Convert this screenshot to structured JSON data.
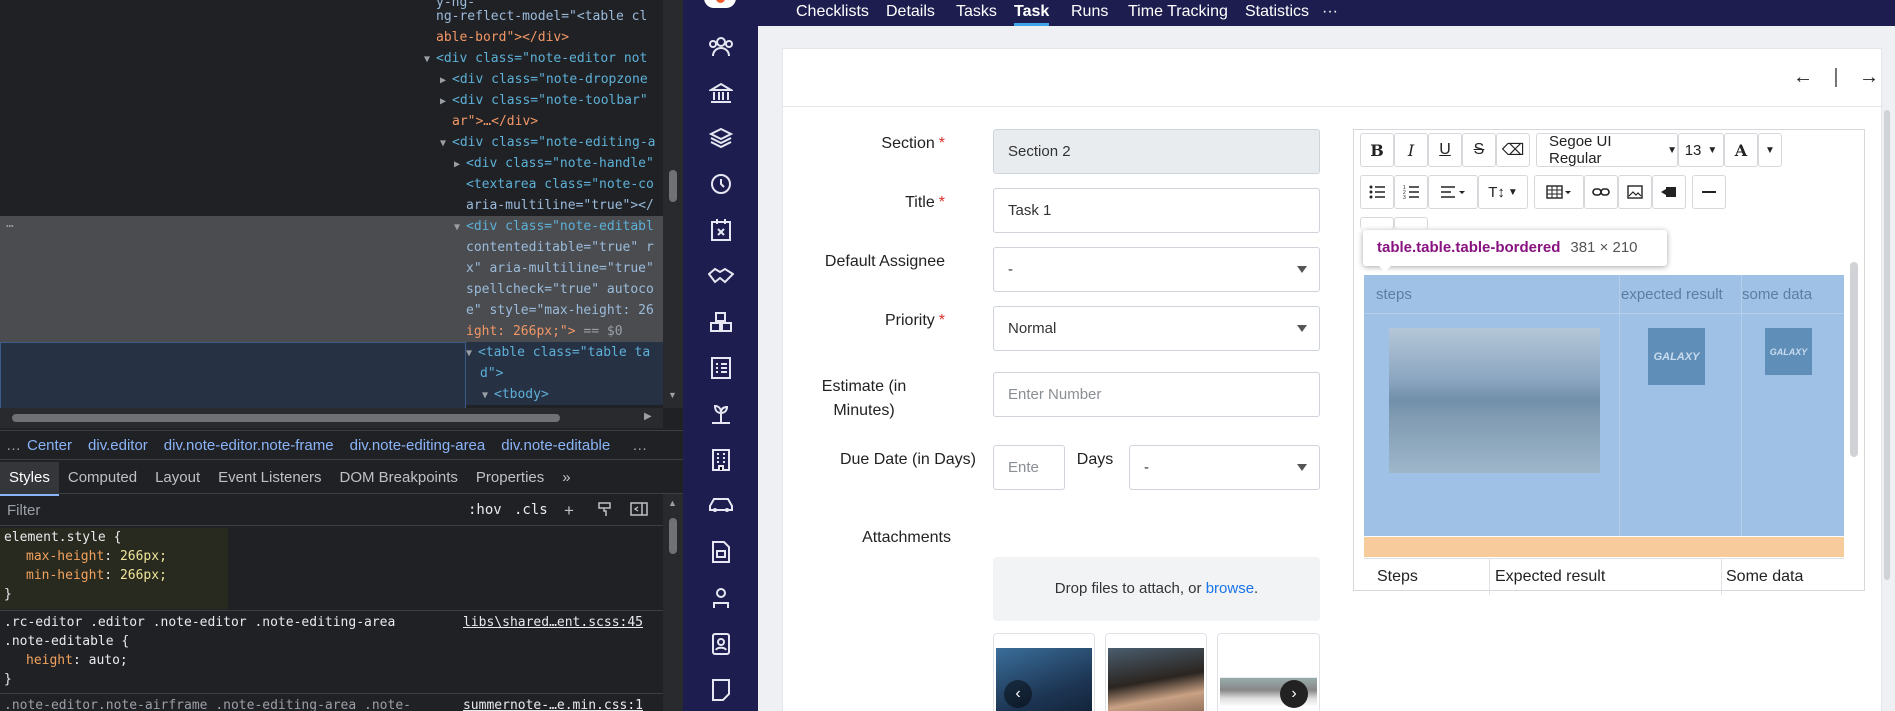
{
  "devtools": {
    "dom_lines": [
      {
        "text": "ng-reflect-model=\"<table cl",
        "kind": "attr"
      },
      {
        "text": "able-bord\"></div>",
        "kind": "tail"
      },
      {
        "text": "<div class=\"note-editor not",
        "kind": "open"
      },
      {
        "text": "<div class=\"note-dropzone",
        "kind": "closed"
      },
      {
        "text": "<div class=\"note-toolbar\"",
        "kind": "closed"
      },
      {
        "text": "ar\">…</div>",
        "kind": "tail"
      },
      {
        "text": "<div class=\"note-editing-a",
        "kind": "open"
      },
      {
        "text": "<div class=\"note-handle\"",
        "kind": "closed"
      },
      {
        "text": "<textarea class=\"note-co",
        "kind": "leaf"
      },
      {
        "text": "aria-multiline=\"true\"></",
        "kind": "leaf"
      },
      {
        "text": "<div class=\"note-editabl",
        "kind": "open"
      },
      {
        "text": "contenteditable=\"true\" r",
        "kind": "leaf"
      },
      {
        "text": "x\" aria-multiline=\"true\"",
        "kind": "leaf"
      },
      {
        "text": "spellcheck=\"true\" autoco",
        "kind": "leaf"
      },
      {
        "text": "e\" style=\"max-height: 26",
        "kind": "leaf"
      },
      {
        "text": "ight: 266px;\">",
        "kind": "leaf"
      },
      {
        "text": "<table class=\"table ta",
        "kind": "open"
      },
      {
        "text": "d\">",
        "kind": "leaf"
      },
      {
        "text": "<tbody>",
        "kind": "open"
      }
    ],
    "dom_eq": "== $0",
    "dom_ellipsis": "…",
    "breadcrumb": [
      "…",
      "Center",
      "div.editor",
      "div.note-editor.note-frame",
      "div.note-editing-area",
      "div.note-editable",
      "…"
    ],
    "tabs": [
      "Styles",
      "Computed",
      "Layout",
      "Event Listeners",
      "DOM Breakpoints",
      "Properties",
      "»"
    ],
    "active_tab": "Styles",
    "filter_placeholder": "Filter",
    "hov_label": ":hov",
    "cls_label": ".cls",
    "rules": {
      "element_style": "element.style {",
      "max_height_prop": "max-height",
      "max_height_val": "266px;",
      "min_height_prop": "min-height",
      "min_height_val": "266px;",
      "close": "}",
      "rule2_sel1": ".rc-editor .editor .note-editor .note-editing-area",
      "rule2_sel2": ".note-editable {",
      "rule2_src": "libs\\shared…ent.scss:45",
      "height_prop": "height",
      "height_val": "auto;",
      "rule3_sel": ".note-editor.note-airframe .note-editing-area .note-",
      "rule3_src": "summernote-…e.min.css:1"
    }
  },
  "app": {
    "nav_icons": [
      "users-icon",
      "bank-icon",
      "layers-icon",
      "clock-icon",
      "calendar-x-icon",
      "handshake-icon",
      "cubes-icon",
      "checklist-icon",
      "plant-icon",
      "building-icon",
      "car-icon",
      "document-icon",
      "person-icon",
      "contacts-icon",
      "note-icon"
    ],
    "tabs": [
      "Checklists",
      "Details",
      "Tasks",
      "Task",
      "Runs",
      "Time Tracking",
      "Statistics",
      "···"
    ],
    "active_tab": "Task",
    "nav_back": "←",
    "nav_sep": "|",
    "nav_forward": "→",
    "form": {
      "section_label": "Section",
      "section_value": "Section 2",
      "title_label": "Title",
      "title_value": "Task 1",
      "assignee_label": "Default Assignee",
      "assignee_value": "-",
      "priority_label": "Priority",
      "priority_value": "Normal",
      "estimate_label_1": "Estimate (in",
      "estimate_label_2": "Minutes)",
      "estimate_placeholder": "Enter Number",
      "due_label": "Due Date (in Days)",
      "due_placeholder": "Ente",
      "days_label": "Days",
      "days_value": "-",
      "attachments_label": "Attachments",
      "drop_text": "Drop files to attach, or ",
      "drop_link": "browse",
      "drop_end": ".",
      "required_mark": "*"
    },
    "editor": {
      "font_name": "Segoe UI Regular",
      "font_size": "13",
      "tooltip_selector": "table.table.table-bordered",
      "tooltip_dims": "381 × 210",
      "table_headers": [
        "steps",
        "expected result",
        "some data"
      ],
      "row2": [
        "Steps",
        "Expected result",
        "Some data"
      ],
      "logo_text": "GALAXY"
    },
    "colors": {
      "nav_bg": "#1d1e4f",
      "accent": "#3fa3e8",
      "highlight": "#9fc1e5",
      "padding_highlight": "#f8cb9c"
    }
  }
}
